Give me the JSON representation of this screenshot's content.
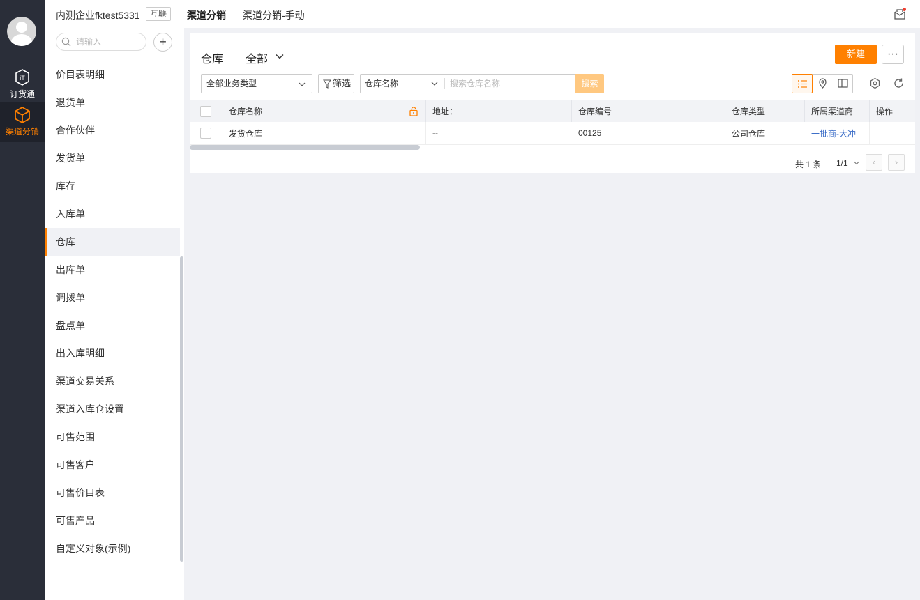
{
  "rail": {
    "items": [
      {
        "label": "订货通",
        "icon": "order-box-icon",
        "active": false
      },
      {
        "label": "渠道分销",
        "icon": "cube-icon",
        "active": true
      }
    ]
  },
  "topbar": {
    "company": "内测企业fktest5331",
    "tag": "互联",
    "title": "渠道分销",
    "subtitle": "渠道分销-手动",
    "mail_icon": "mail-icon"
  },
  "nav": {
    "search_placeholder": "请输入",
    "add_label": "+",
    "items": [
      "价目表明细",
      "退货单",
      "合作伙伴",
      "发货单",
      "库存",
      "入库单",
      "仓库",
      "出库单",
      "调拨单",
      "盘点单",
      "出入库明细",
      "渠道交易关系",
      "渠道入库仓设置",
      "可售范围",
      "可售客户",
      "可售价目表",
      "可售产品",
      "自定义对象(示例)"
    ],
    "active_index": 6
  },
  "main": {
    "title": "仓库",
    "scope": "全部",
    "new_label": "新建",
    "more_label": "···",
    "business_type": "全部业务类型",
    "filter_label": "筛选",
    "search_field": "仓库名称",
    "search_placeholder": "搜索仓库名称",
    "search_button": "搜索",
    "columns": [
      "仓库名称",
      "地址：",
      "仓库编号",
      "仓库类型",
      "所属渠道商",
      "操作"
    ],
    "rows": [
      {
        "name": "发货仓库",
        "address": "--",
        "code": "00125",
        "type": "公司仓库",
        "channel": "一批商-大冲",
        "action": ""
      }
    ],
    "pagination": {
      "total": "共 1 条",
      "page": "1/1"
    }
  },
  "colors": {
    "accent": "#ff8000",
    "rail_bg": "#2a2e39",
    "link": "#3c6ec8"
  }
}
